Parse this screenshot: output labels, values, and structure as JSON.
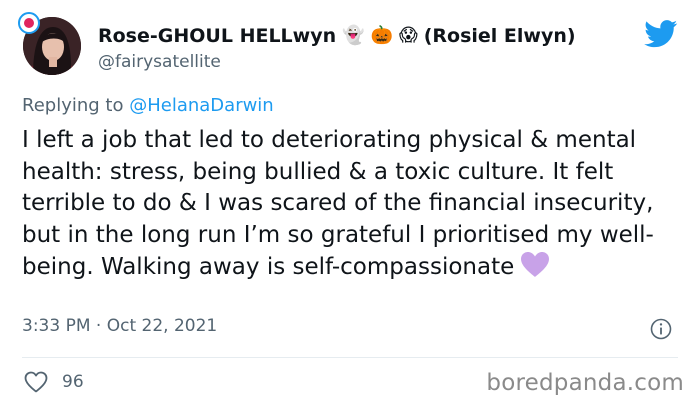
{
  "header": {
    "display_name": "Rose-GHOUL HELLwyn",
    "emojis": [
      "👻",
      "🎃",
      "😱"
    ],
    "alt_name": "(Rosiel Elwyn)",
    "handle": "@fairysatellite",
    "avatar_icon": "profile-photo",
    "logo_icon": "twitter-bird-icon"
  },
  "reply": {
    "prefix": "Replying to",
    "mention": "@HelanaDarwin"
  },
  "body": {
    "text": "I left a job that led to deteriorating physical & mental health: stress, being bullied & a toxic culture. It felt terrible to do & I was scared of the financial insecurity, but in the long run I’m so grateful I prioritised my well-being. Walking away is self-compassionate",
    "trailing_emoji": "purple-heart"
  },
  "meta": {
    "time": "3:33 PM",
    "separator": "·",
    "date": "Oct 22, 2021"
  },
  "footer": {
    "like_count": "96",
    "watermark": "boredpanda.com"
  },
  "colors": {
    "twitter_blue": "#1d9bf0",
    "text_primary": "#0f1419",
    "text_secondary": "#536471",
    "heart_purple": "#c8a2e8",
    "divider": "#e6ecf0"
  }
}
